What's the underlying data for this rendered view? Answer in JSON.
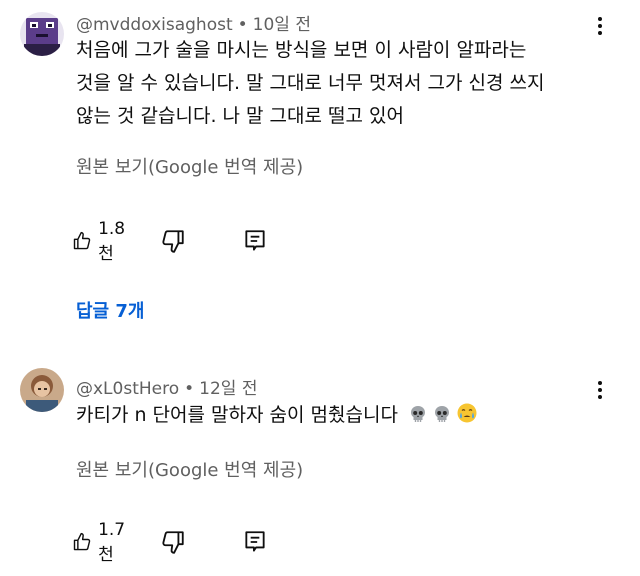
{
  "comments": [
    {
      "author": "@mvddoxisaghost",
      "time": "10일 전",
      "text": "처음에 그가 술을 마시는 방식을 보면 이 사람이 알파라는\n것을 알 수 있습니다. 말 그대로 너무 멋져서 그가 신경 쓰지\n않는 것 같습니다. 나 말 그대로 떨고 있어",
      "translate_label": "원본 보기(Google 번역 제공)",
      "likes": "1.8천",
      "replies_label": "답글 7개"
    },
    {
      "author": "@xL0stHero",
      "time": "12일 전",
      "text": "카티가 n 단어를 말하자 숨이 멈췄습니다",
      "emojis": [
        "skull-emoji",
        "skull-emoji",
        "crying-face-emoji"
      ],
      "translate_label": "원본 보기(Google 번역 제공)",
      "likes": "1.7천"
    }
  ],
  "separator": "•",
  "colors": {
    "text": "#0f0f0f",
    "secondary": "#606060",
    "link": "#065fd4",
    "background": "#ffffff"
  }
}
